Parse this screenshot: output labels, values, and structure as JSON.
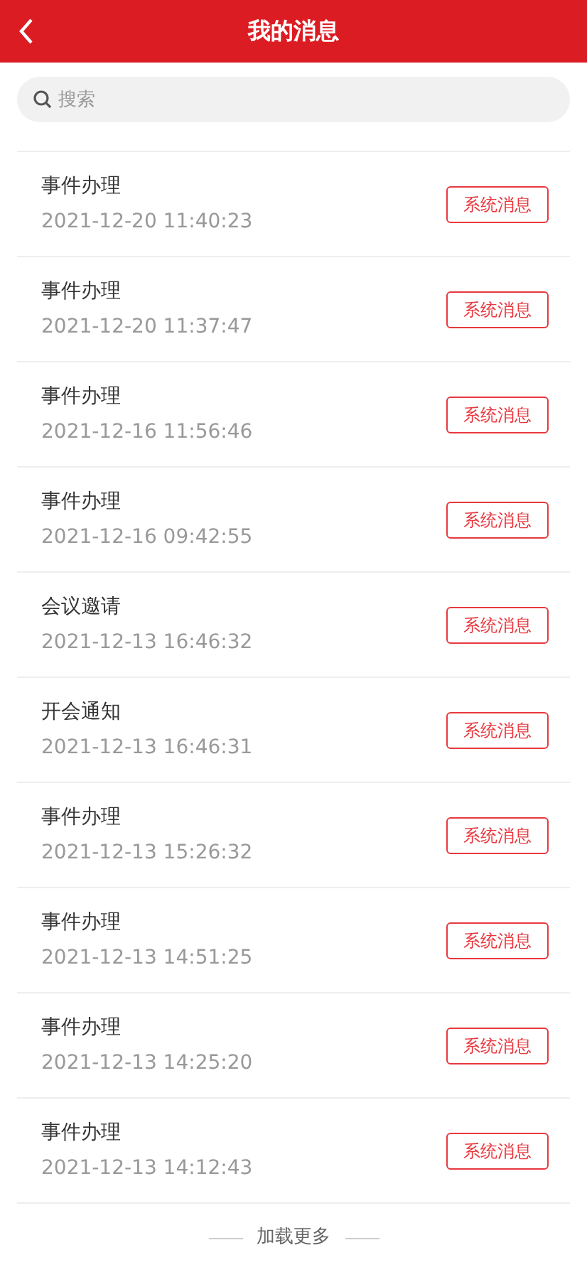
{
  "header": {
    "title": "我的消息"
  },
  "search": {
    "placeholder": "搜索"
  },
  "messages": [
    {
      "title": "事件办理",
      "time": "2021-12-20 11:40:23",
      "tag": "系统消息"
    },
    {
      "title": "事件办理",
      "time": "2021-12-20 11:37:47",
      "tag": "系统消息"
    },
    {
      "title": "事件办理",
      "time": "2021-12-16 11:56:46",
      "tag": "系统消息"
    },
    {
      "title": "事件办理",
      "time": "2021-12-16 09:42:55",
      "tag": "系统消息"
    },
    {
      "title": "会议邀请",
      "time": "2021-12-13 16:46:32",
      "tag": "系统消息"
    },
    {
      "title": "开会通知",
      "time": "2021-12-13 16:46:31",
      "tag": "系统消息"
    },
    {
      "title": "事件办理",
      "time": "2021-12-13 15:26:32",
      "tag": "系统消息"
    },
    {
      "title": "事件办理",
      "time": "2021-12-13 14:51:25",
      "tag": "系统消息"
    },
    {
      "title": "事件办理",
      "time": "2021-12-13 14:25:20",
      "tag": "系统消息"
    },
    {
      "title": "事件办理",
      "time": "2021-12-13 14:12:43",
      "tag": "系统消息"
    }
  ],
  "load_more": "加载更多"
}
